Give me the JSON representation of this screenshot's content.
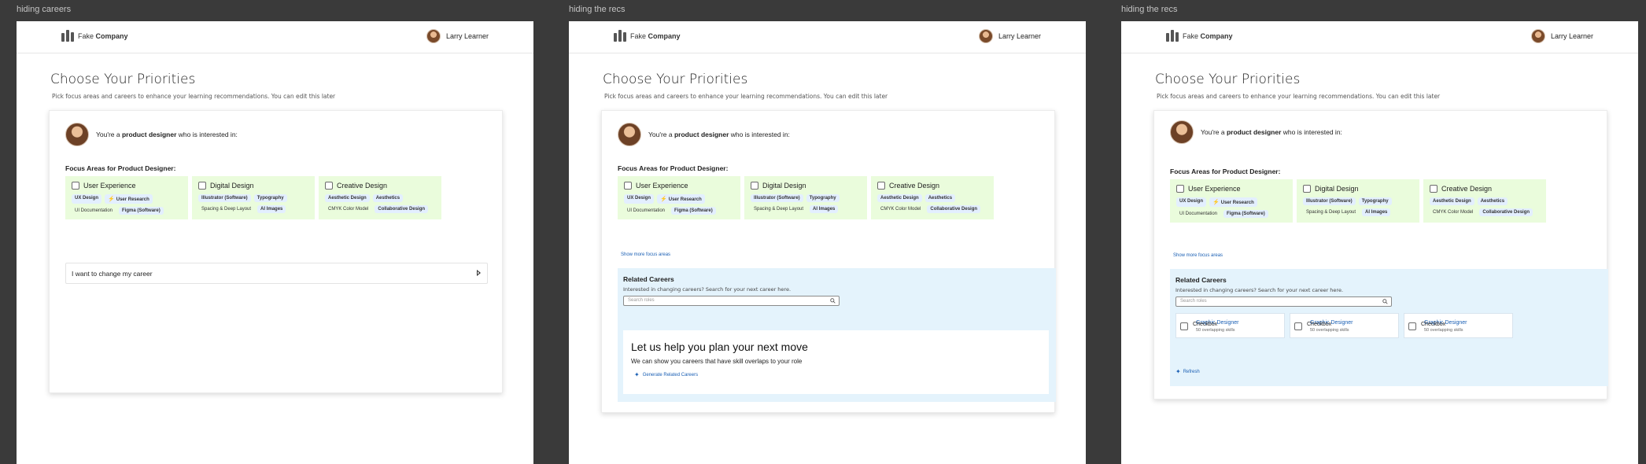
{
  "frames": [
    {
      "label": "hiding careers"
    },
    {
      "label": "hiding the recs"
    },
    {
      "label": "hiding the recs"
    }
  ],
  "company": {
    "light": "Fake",
    "bold": "Company"
  },
  "user": {
    "name": "Larry Learner"
  },
  "page": {
    "title": "Choose Your Priorities",
    "subtitle": "Pick focus areas and careers to enhance your learning recommendations. You can edit this later"
  },
  "intro": {
    "prefix": "You're a ",
    "role": "product designer",
    "suffix": " who is interested in:"
  },
  "focus": {
    "title": "Focus Areas for Product Designer:",
    "areas": [
      {
        "name": "User Experience",
        "tags": [
          "UX Design",
          "User Research",
          "UI Documentation",
          "Figma (Software)"
        ]
      },
      {
        "name": "Digital Design",
        "tags": [
          "Illustrator (Software)",
          "Typography",
          "Spacing & Deep Layout",
          "AI Images"
        ]
      },
      {
        "name": "Creative Design",
        "tags": [
          "Aesthetic Design",
          "Aesthetics",
          "CMYK Color Model",
          "Collaborative Design"
        ]
      }
    ],
    "show_more": "Show more focus areas"
  },
  "change_career": {
    "label": "I want to change my career"
  },
  "related": {
    "title": "Related Careers",
    "subtitle": "Interested in changing careers? Search for your next career here.",
    "search_placeholder": "Search roles",
    "plan_title": "Let us help you plan your next move",
    "plan_text": "We can show you careers that have skill overlaps to your role",
    "generate_label": "Generate Related Careers",
    "careers": [
      {
        "name": "Graphic Designer",
        "overlay": "Checkbox",
        "skills": "50 overlapping skills"
      },
      {
        "name": "Graphic Designer",
        "overlay": "Checkbox",
        "skills": "50 overlapping skills"
      },
      {
        "name": "Graphic Designer",
        "overlay": "Checkbox",
        "skills": "50 overlapping skills"
      }
    ],
    "refresh_label": "Refresh"
  }
}
